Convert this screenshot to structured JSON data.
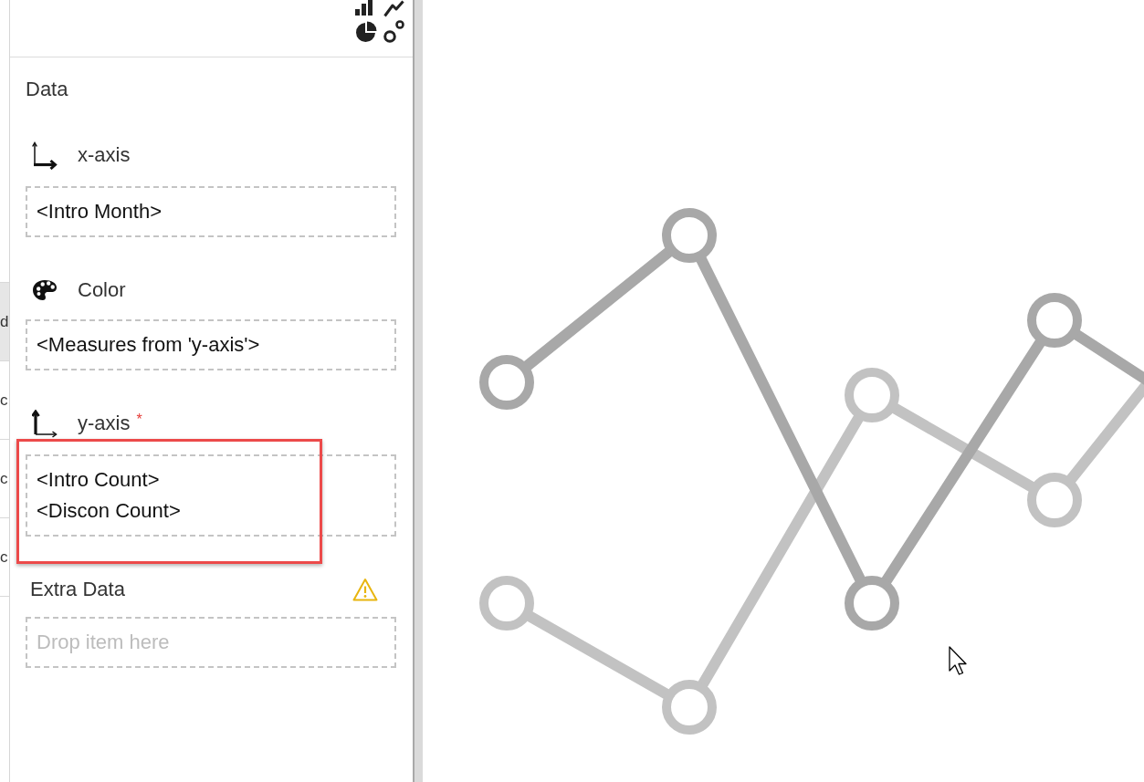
{
  "side_list": {
    "rows": [
      {
        "text": "d",
        "selected": true
      },
      {
        "text": "c",
        "selected": false
      },
      {
        "text": "c",
        "selected": false
      },
      {
        "text": "c",
        "selected": false
      }
    ]
  },
  "panel": {
    "title": "Data",
    "sections": [
      {
        "kind": "xaxis",
        "label": "x-axis",
        "items": [
          "<Intro Month>"
        ]
      },
      {
        "kind": "color",
        "label": "Color",
        "items": [
          "<Measures from 'y-axis'>"
        ]
      },
      {
        "kind": "yaxis",
        "label": "y-axis",
        "required_mark": "*",
        "highlighted": true,
        "items": [
          "<Intro Count>",
          "<Discon Count>"
        ]
      },
      {
        "kind": "extra",
        "label": "Extra Data",
        "warning": true,
        "placeholder": "Drop item here"
      }
    ]
  }
}
